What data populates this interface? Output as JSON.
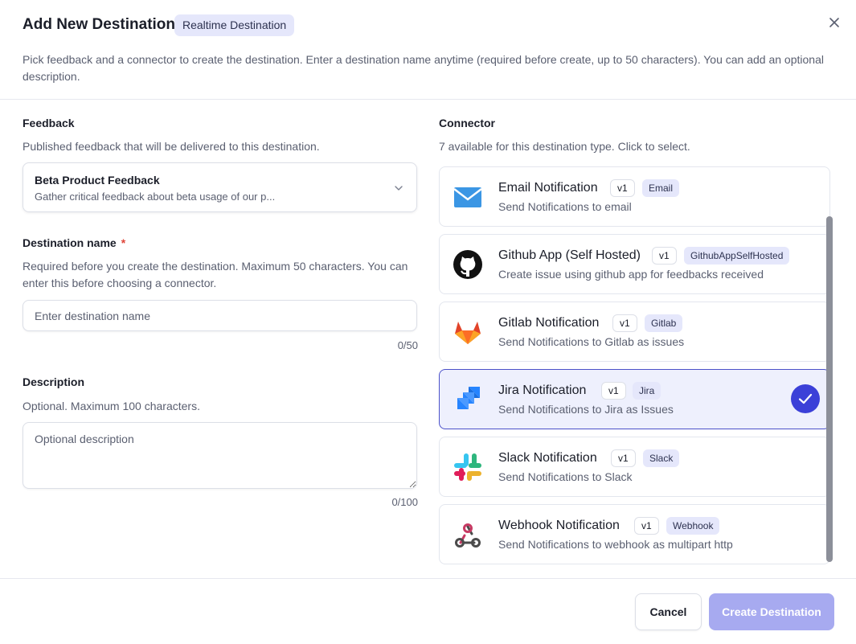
{
  "dialog": {
    "title": "Add New Destination",
    "type_badge": "Realtime Destination",
    "subtitle": "Pick feedback and a connector to create the destination. Enter a destination name anytime (required before create, up to 50 characters). You can add an optional description.",
    "close_icon": "close-icon"
  },
  "feedback": {
    "label": "Feedback",
    "help": "Published feedback that will be delivered to this destination.",
    "selected_title": "Beta Product Feedback",
    "selected_desc": "Gather critical feedback about beta usage of our p..."
  },
  "destination_name": {
    "label": "Destination name",
    "required_mark": "*",
    "help": "Required before you create the destination. Maximum 50 characters. You can enter this before choosing a connector.",
    "placeholder": "Enter destination name",
    "value": "",
    "counter": "0/50"
  },
  "description": {
    "label": "Description",
    "help": "Optional. Maximum 100 characters.",
    "placeholder": "Optional description",
    "value": "",
    "counter": "0/100"
  },
  "connector": {
    "label": "Connector",
    "help": "7 available for this destination type. Click to select.",
    "items": [
      {
        "name": "Email Notification",
        "version": "v1",
        "key": "Email",
        "desc": "Send Notifications to email",
        "icon": "email-icon",
        "selected": false
      },
      {
        "name": "Github App (Self Hosted)",
        "version": "v1",
        "key": "GithubAppSelfHosted",
        "desc": "Create issue using github app for feedbacks received",
        "icon": "github-icon",
        "selected": false
      },
      {
        "name": "Gitlab Notification",
        "version": "v1",
        "key": "Gitlab",
        "desc": "Send Notifications to Gitlab as issues",
        "icon": "gitlab-icon",
        "selected": false
      },
      {
        "name": "Jira Notification",
        "version": "v1",
        "key": "Jira",
        "desc": "Send Notifications to Jira as Issues",
        "icon": "jira-icon",
        "selected": true
      },
      {
        "name": "Slack Notification",
        "version": "v1",
        "key": "Slack",
        "desc": "Send Notifications to Slack",
        "icon": "slack-icon",
        "selected": false
      },
      {
        "name": "Webhook Notification",
        "version": "v1",
        "key": "Webhook",
        "desc": "Send Notifications to webhook as multipart http",
        "icon": "webhook-icon",
        "selected": false
      }
    ]
  },
  "footer": {
    "cancel_label": "Cancel",
    "create_label": "Create Destination"
  },
  "colors": {
    "accent": "#3b40d8",
    "primary_disabled": "#a7aaf0",
    "badge_bg": "#e5e7fb",
    "selected_bg": "#eef0fd"
  }
}
